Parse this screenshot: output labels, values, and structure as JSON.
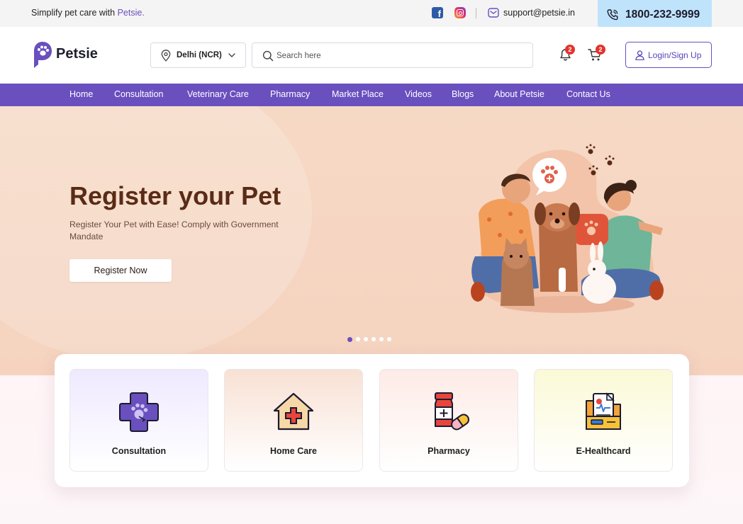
{
  "topbar": {
    "tagline_prefix": "Simplify pet care with ",
    "tagline_brand": "Petsie.",
    "email": "support@petsie.in",
    "phone": "1800-232-9999",
    "icons": [
      "facebook-icon",
      "instagram-icon",
      "mail-icon",
      "phone-icon"
    ]
  },
  "header": {
    "logo_text": "Petsie",
    "location": "Delhi (NCR)",
    "search_placeholder": "Search here",
    "notifications_count": "2",
    "cart_count": "2",
    "login_label": "Login/Sign Up"
  },
  "nav": {
    "items": [
      {
        "label": "Home"
      },
      {
        "label": "Consultation"
      },
      {
        "label": "Veterinary Care"
      },
      {
        "label": "Pharmacy"
      },
      {
        "label": "Market Place"
      },
      {
        "label": "Videos"
      },
      {
        "label": "Blogs"
      },
      {
        "label": "About Petsie"
      },
      {
        "label": "Contact Us"
      }
    ]
  },
  "hero": {
    "title": "Register your Pet",
    "subtitle": "Register Your Pet with Ease! Comply with Government Mandate",
    "cta_label": "Register Now",
    "slides_total": 6,
    "active_slide": 1
  },
  "services": [
    {
      "label": "Consultation",
      "icon": "medical-cross-paw-icon"
    },
    {
      "label": "Home Care",
      "icon": "house-cross-icon"
    },
    {
      "label": "Pharmacy",
      "icon": "medicine-bottle-icon"
    },
    {
      "label": "E-Healthcard",
      "icon": "health-folder-icon"
    }
  ],
  "colors": {
    "brand": "#6a4fbf",
    "phone_bg": "#bfe3fb",
    "hero_bg": "#f6d9c5",
    "hero_title": "#5a2b16",
    "badge": "#e5322d"
  }
}
